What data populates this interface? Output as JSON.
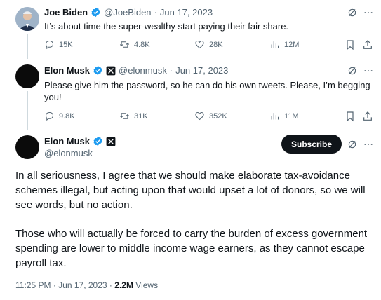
{
  "tweet1": {
    "name": "Joe Biden",
    "handle": "@JoeBiden",
    "date": "Jun 17, 2023",
    "text": "It’s about time the super-wealthy start paying their fair share.",
    "replies": "15K",
    "retweets": "4.8K",
    "likes": "28K",
    "views": "12M"
  },
  "tweet2": {
    "name": "Elon Musk",
    "handle": "@elonmusk",
    "date": "Jun 17, 2023",
    "text": "Please give him the password, so he can do his own tweets. Please, I’m begging you!",
    "replies": "9.8K",
    "retweets": "31K",
    "likes": "352K",
    "views": "11M"
  },
  "main_tweet": {
    "name": "Elon Musk",
    "handle": "@elonmusk",
    "subscribe_label": "Subscribe",
    "paragraph1": "In all seriousness, I agree that we should make elaborate tax-avoidance schemes illegal, but acting upon that would upset a lot of donors, so we will see words, but no action.",
    "paragraph2": "Those who will actually be forced to carry the burden of excess government spending are lower to middle income wage earners, as they cannot escape payroll tax.",
    "time": "11:25 PM",
    "date": "Jun 17, 2023",
    "views_count": "2.2M",
    "views_label": "Views"
  },
  "separator": "·",
  "colors": {
    "verified_blue": "#1d9bf0",
    "text": "#0f1419",
    "secondary": "#536471"
  },
  "icons": [
    "verified-badge-icon",
    "x-logo-icon",
    "grok-icon",
    "more-icon",
    "reply-icon",
    "retweet-icon",
    "like-icon",
    "views-icon",
    "bookmark-icon",
    "share-icon"
  ]
}
